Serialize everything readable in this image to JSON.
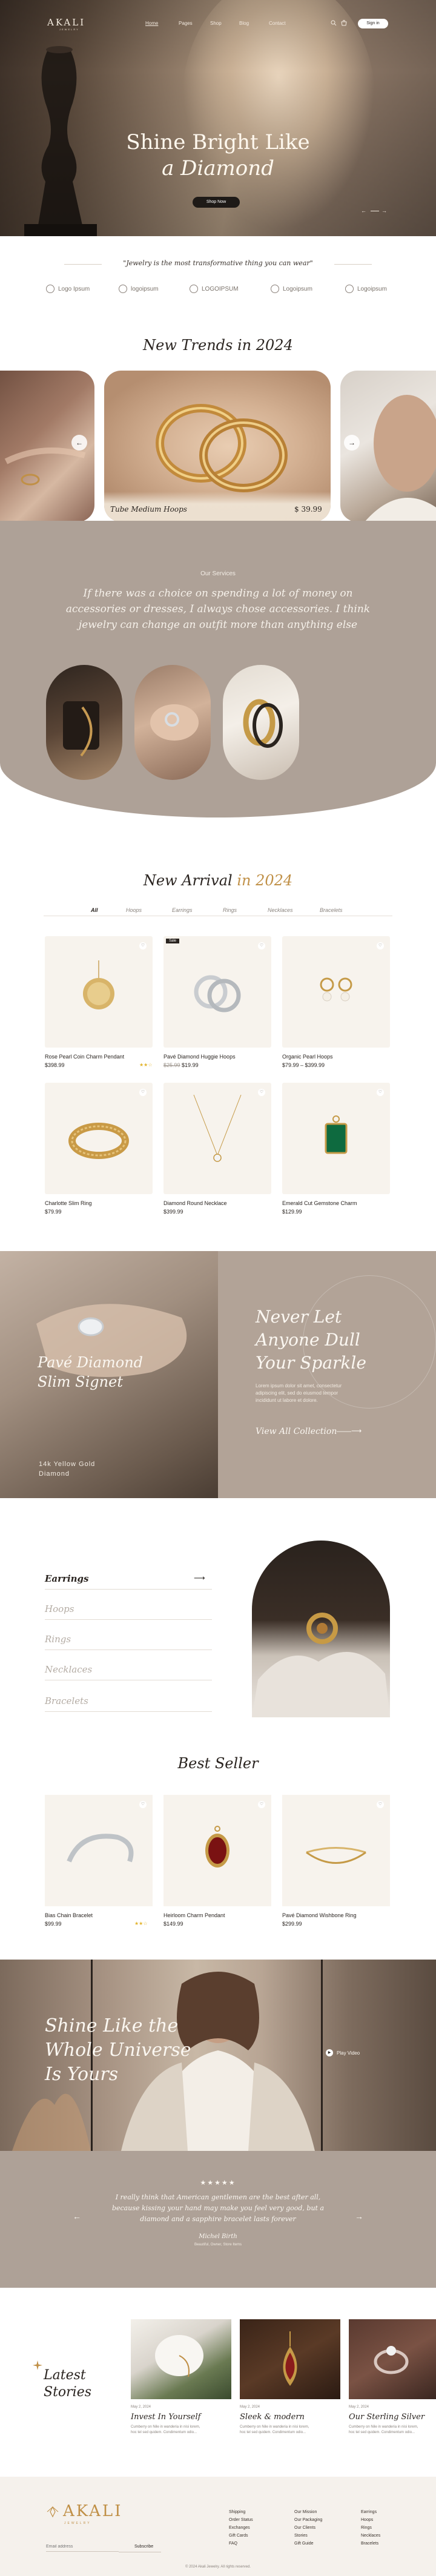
{
  "header": {
    "logo": "AKALI",
    "logo_sub": "JEWELRY",
    "nav": [
      "Home",
      "Pages",
      "Shop",
      "Blog",
      "Contact"
    ],
    "icons": [
      "search-icon",
      "cart-icon"
    ],
    "signin_label": "Sign in"
  },
  "hero": {
    "title_line1": "Shine Bright Like",
    "title_line2": "a Diamond",
    "button_label": "Shop Now"
  },
  "quote": "\"Jewelry is the most transformative thing you can wear\"",
  "partner_logos": [
    "Logo Ipsum",
    "logoipsum",
    "LOGOIPSUM",
    "Logoipsum",
    "Logoipsum"
  ],
  "trends": {
    "title_part1": "New Trends in",
    "title_part2": "2024",
    "featured_name": "Tube Medium Hoops",
    "featured_price": "$ 39.99"
  },
  "services": {
    "label": "Our Services",
    "quote_line1": "If there was a choice on spending a lot of money on",
    "quote_line2": "accessories or dresses, I always chose accessories. I think",
    "quote_line3": "jewelry can change an outfit more than anything else"
  },
  "arrival": {
    "title_part1": "New Arrival",
    "title_part2": "in 2024",
    "tabs": [
      "All",
      "Hoops",
      "Earrings",
      "Rings",
      "Necklaces",
      "Bracelets"
    ],
    "products": [
      {
        "name": "Rose Pearl Coin Charm Pendant",
        "price": "$398.99",
        "old_price": "",
        "badge": ""
      },
      {
        "name": "Pavé Diamond Huggie Hoops",
        "price": "$19.99",
        "old_price": "$25.99",
        "badge": "Sale"
      },
      {
        "name": "Organic Pearl Hoops",
        "price": "$79.99 – $399.99",
        "old_price": "",
        "badge": ""
      },
      {
        "name": "Charlotte Slim Ring",
        "price": "$79.99",
        "old_price": "",
        "badge": ""
      },
      {
        "name": "Diamond Round Necklace",
        "price": "$399.99",
        "old_price": "",
        "badge": ""
      },
      {
        "name": "Emerald Cut Gemstone Charm",
        "price": "$129.99",
        "old_price": "",
        "badge": ""
      }
    ]
  },
  "pave": {
    "title_line1": "Pavé Diamond",
    "title_line2": "Slim Signet",
    "subtitle_line1": "14k Yellow Gold",
    "subtitle_line2": "Diamond",
    "headline_line1": "Never Let",
    "headline_line2": "Anyone Dull",
    "headline_line3": "Your Sparkle",
    "body_line1": "Lorem ipsum dolor sit amet, consectetur",
    "body_line2": "adipiscing elit, sed do eiusmod tempor",
    "body_line3": "incididunt ut labore et dolore.",
    "link_label": "View All Collection"
  },
  "categories": [
    "Earrings",
    "Hoops",
    "Rings",
    "Necklaces",
    "Bracelets"
  ],
  "best_seller": {
    "title": "Best Seller",
    "products": [
      {
        "name": "Bias Chain Bracelet",
        "price": "$99.99"
      },
      {
        "name": "Heirloom Charm Pendant",
        "price": "$149.99"
      },
      {
        "name": "Pavé Diamond Wishbone Ring",
        "price": "$299.99"
      }
    ]
  },
  "universe": {
    "title_line1": "Shine Like the",
    "title_line2": "Whole Universe",
    "title_line3": "Is Yours",
    "play_label": "Play Video"
  },
  "testimonial": {
    "stars": "★★★★★",
    "line1": "I really think that American gentlemen are the best after all,",
    "line2": "because kissing your hand may make you feel very good, but a",
    "line3": "diamond and a sapphire bracelet lasts forever",
    "author": "Michel Birth",
    "role": "Beautiful, Owner, Store Items"
  },
  "stories": {
    "title_line1": "Latest",
    "title_line2": "Stories",
    "items": [
      {
        "meta": "May 2, 2024",
        "title": "Invest In Yourself",
        "text_line1": "Cumberry on Nile in wanderia in nisi lorem,",
        "text_line2": "hoc tel sed quidem. Condimentum odio..."
      },
      {
        "meta": "May 2, 2024",
        "title": "Sleek & modern",
        "text_line1": "Cumberry on Nile in wanderia in nisi lorem,",
        "text_line2": "hoc tel sed quidem. Condimentum odio..."
      },
      {
        "meta": "May 2, 2024",
        "title": "Our Sterling Silver",
        "text_line1": "Cumberry on Nile in wanderia in nisi lorem,",
        "text_line2": "hoc tel sed quidem. Condimentum odio..."
      }
    ]
  },
  "footer": {
    "logo": "AKALI",
    "logo_sub": "JEWELRY",
    "email_placeholder": "Email address",
    "subscribe_label": "Subscribe",
    "col1": [
      "Shipping",
      "Order Status",
      "Exchanges",
      "Gift Cards",
      "FAQ"
    ],
    "col2": [
      "Our Mission",
      "Our Packaging",
      "Our Clients",
      "Stories",
      "Gift Guide"
    ],
    "col3": [
      "Earrings",
      "Hoops",
      "Rings",
      "Necklaces",
      "Bracelets"
    ],
    "copyright": "© 2024 Akali Jewelry. All rights reserved."
  }
}
